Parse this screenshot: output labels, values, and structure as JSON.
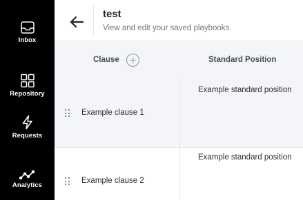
{
  "sidebar": {
    "items": [
      {
        "label": "Inbox",
        "icon": "inbox-icon"
      },
      {
        "label": "Repository",
        "icon": "grid-icon"
      },
      {
        "label": "Requests",
        "icon": "lightning-icon"
      },
      {
        "label": "Analytics",
        "icon": "trend-line-icon"
      }
    ]
  },
  "header": {
    "title": "test",
    "subtitle": "View and edit your saved playbooks.",
    "back_icon": "arrow-left-icon"
  },
  "table": {
    "columns": [
      "Clause",
      "Standard Position"
    ],
    "add_icon": "plus-circle-icon",
    "rows": [
      {
        "clause": "Example clause 1",
        "position": "Example standard position"
      },
      {
        "clause": "Example clause 2",
        "position": "Example standard position"
      }
    ]
  },
  "colors": {
    "sidebar_bg": "#000000",
    "header_bg": "#ffffff",
    "row_alt_bg": "#f4f5f9",
    "text": "#24262b",
    "muted_text": "#71767f"
  }
}
